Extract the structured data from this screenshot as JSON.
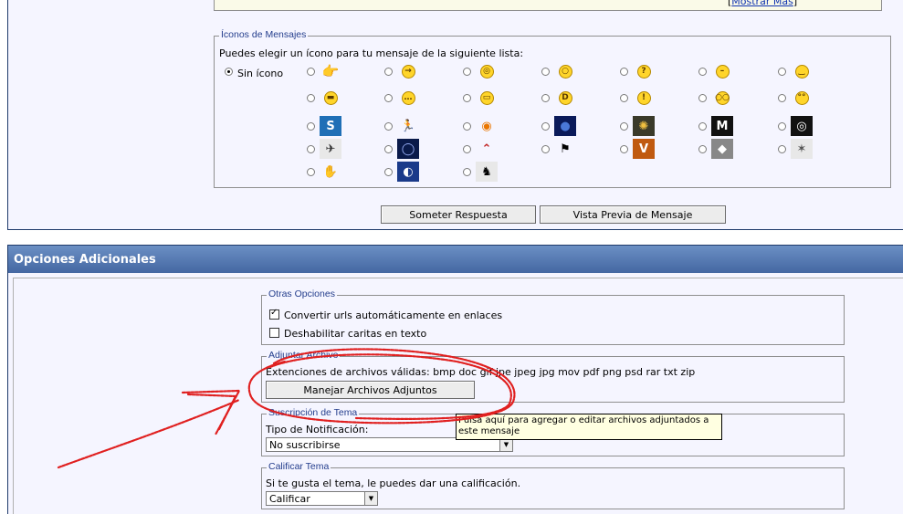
{
  "top_panel": {
    "show_more_link": "Mostrar Más",
    "message_icons": {
      "legend": "Íconos de Mensajes",
      "instruction": "Puedes elegir un ícono para tu mensaje de la siguiente lista:",
      "no_icon_label": "Sin ícono",
      "selected": "Sin ícono"
    },
    "submit_button": "Someter Respuesta",
    "preview_button": "Vista Previa de Mensaje"
  },
  "options_panel": {
    "header": "Opciones Adicionales",
    "other_options": {
      "legend": "Otras Opciones",
      "convert_urls_label": "Convertir urls automáticamente en enlaces",
      "convert_urls_checked": true,
      "disable_smilies_label": "Deshabilitar caritas en texto",
      "disable_smilies_checked": false
    },
    "attach": {
      "legend": "Adjuntar Archivo",
      "extensions": "Extenciones de archivos válidas: bmp doc gif jpe jpeg jpg mov pdf png psd rar txt zip",
      "manage_button": "Manejar Archivos Adjuntos",
      "tooltip": "Pulsa aquí para agregar o editar archivos adjuntados a este mensaje"
    },
    "subscription": {
      "legend": "Suscripción de Tema",
      "notification_label": "Tipo de Notificación:",
      "notification_value": "No suscribirse"
    },
    "rate": {
      "legend": "Calificar Tema",
      "instruction": "Si te gusta el tema, le puedes dar una calificación.",
      "rate_value": "Calificar"
    }
  },
  "colors": {
    "header_blue": "#4a6ca8",
    "panel_bg": "#f5f5ff",
    "legend_text": "#233d8c",
    "annotation_red": "#e02020",
    "tooltip_bg": "#ffffe1"
  },
  "icons": [
    "sin-icono",
    "pointing-hand-icon",
    "arrow-right-icon",
    "crazy-eyes-icon",
    "shocked-icon",
    "question-icon",
    "neutral-face-icon",
    "wink-face-icon",
    "cool-face-icon",
    "thinking-face-icon",
    "grin-teeth-icon",
    "big-smile-icon",
    "popcorn-icon",
    "looking-icon",
    "rolling-eyes-icon",
    "3dsmax-icon",
    "running-man-icon",
    "blender-icon",
    "sphere-icon",
    "lightwave-icon",
    "maya-icon",
    "cinema4d-icon",
    "xsi-icon",
    "eye-icon",
    "bird-logo-icon",
    "zbrush-man-icon",
    "vray-icon",
    "houdini-icon",
    "gimp-icon",
    "hand-icon",
    "poser-icon",
    "horse-icon"
  ]
}
